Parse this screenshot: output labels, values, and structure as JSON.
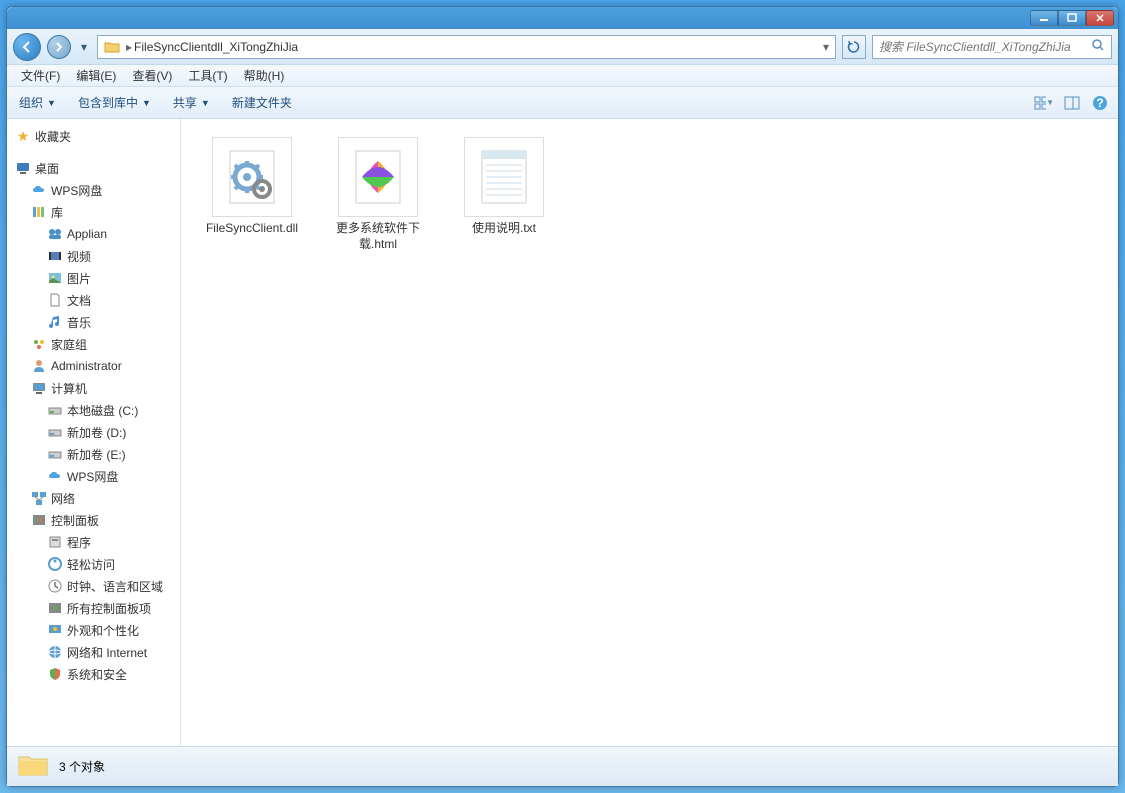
{
  "window": {
    "path": "FileSyncClientdll_XiTongZhiJia",
    "search_placeholder": "搜索 FileSyncClientdll_XiTongZhiJia"
  },
  "menu": {
    "file": "文件(F)",
    "edit": "编辑(E)",
    "view": "查看(V)",
    "tools": "工具(T)",
    "help": "帮助(H)"
  },
  "toolbar": {
    "organize": "组织",
    "include": "包含到库中",
    "share": "共享",
    "newfolder": "新建文件夹"
  },
  "sidebar": {
    "favorites": "收藏夹",
    "desktop": "桌面",
    "wps": "WPS网盘",
    "libraries": "库",
    "applian": "Applian",
    "videos": "视频",
    "pictures": "图片",
    "documents": "文档",
    "music": "音乐",
    "homegroup": "家庭组",
    "admin": "Administrator",
    "computer": "计算机",
    "cdrive": "本地磁盘 (C:)",
    "ddrive": "新加卷 (D:)",
    "edrive": "新加卷 (E:)",
    "wps2": "WPS网盘",
    "network": "网络",
    "cpanel": "控制面板",
    "programs": "程序",
    "ease": "轻松访问",
    "clock": "时钟、语言和区域",
    "allcpl": "所有控制面板项",
    "appearance": "外观和个性化",
    "netint": "网络和 Internet",
    "security": "系统和安全"
  },
  "files": [
    {
      "name": "FileSyncClient.dll",
      "type": "dll"
    },
    {
      "name": "更多系统软件下载.html",
      "type": "html"
    },
    {
      "name": "使用说明.txt",
      "type": "txt"
    }
  ],
  "status": {
    "count": "3 个对象"
  }
}
